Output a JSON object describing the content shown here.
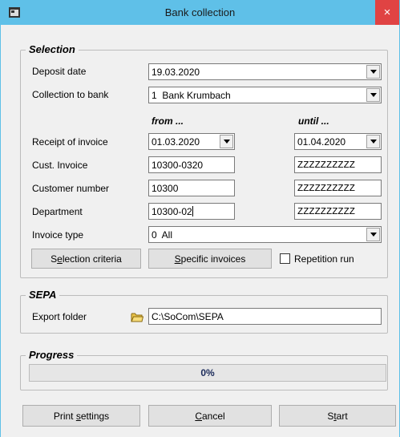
{
  "window": {
    "title": "Bank collection",
    "close_glyph": "×"
  },
  "icons": {
    "app": "app-window-icon",
    "close": "close-icon",
    "dropdown": "chevron-down-icon",
    "folder": "folder-icon"
  },
  "colors": {
    "titlebar": "#5fc0e8",
    "close": "#e04343"
  },
  "selection": {
    "title": "Selection",
    "deposit_date_label": "Deposit date",
    "deposit_date_value": "19.03.2020",
    "collection_bank_label": "Collection to bank",
    "collection_bank_value": "1  Bank Krumbach",
    "from_header": "from ...",
    "until_header": "until ...",
    "receipt_label": "Receipt of invoice",
    "receipt_from": "01.03.2020",
    "receipt_until": "01.04.2020",
    "cust_invoice_label": "Cust. Invoice",
    "cust_invoice_from": "10300-0320",
    "cust_invoice_until": "ZZZZZZZZZZ",
    "customer_number_label": "Customer number",
    "customer_number_from": "10300",
    "customer_number_until": "ZZZZZZZZZZ",
    "department_label": "Department",
    "department_from": "10300-02",
    "department_until": "ZZZZZZZZZZ",
    "invoice_type_label": "Invoice type",
    "invoice_type_value": "0  All",
    "selection_criteria_pre": "S",
    "selection_criteria_key": "e",
    "selection_criteria_post": "lection criteria",
    "specific_invoices_key": "S",
    "specific_invoices_post": "pecific invoices",
    "repetition_run_label": "Repetition run",
    "repetition_run_checked": false
  },
  "sepa": {
    "title": "SEPA",
    "export_folder_label": "Export folder",
    "export_folder_value": "C:\\SoCom\\SEPA"
  },
  "progress": {
    "title": "Progress",
    "percent_text": "0%",
    "value": 0
  },
  "footer": {
    "print_pre": "Print ",
    "print_key": "s",
    "print_post": "ettings",
    "cancel_key": "C",
    "cancel_post": "ancel",
    "start_pre": "S",
    "start_key": "t",
    "start_post": "art"
  }
}
